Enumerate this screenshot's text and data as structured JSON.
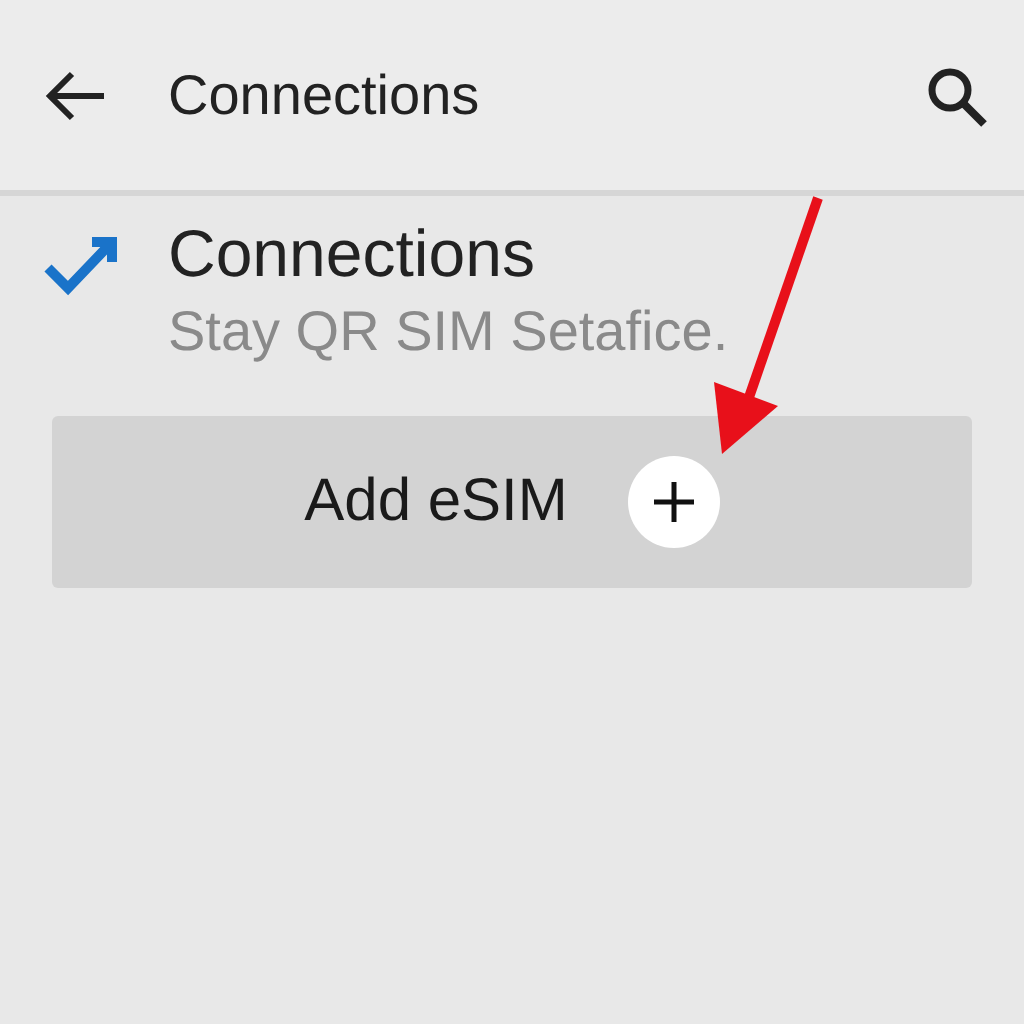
{
  "header": {
    "title": "Connections"
  },
  "item": {
    "title": "Connections",
    "subtitle": "Stay QR SIM Setafice."
  },
  "button": {
    "label": "Add eSIM"
  }
}
